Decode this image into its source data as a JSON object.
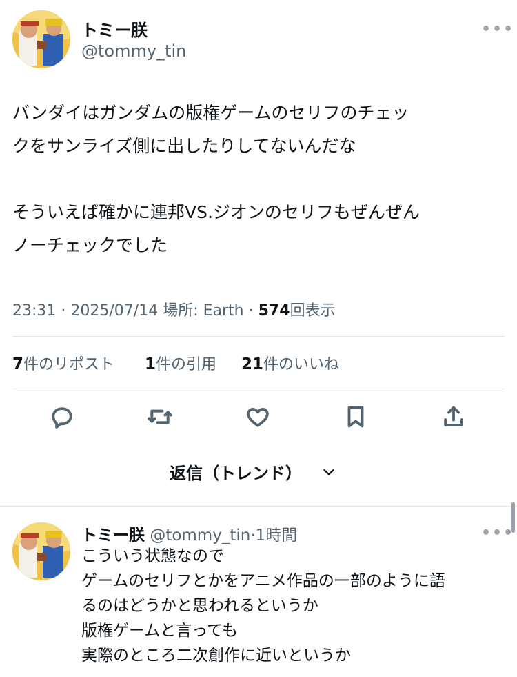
{
  "main_tweet": {
    "author": {
      "display_name": "トミー朕",
      "handle": "@tommy_tin"
    },
    "body": "バンダイはガンダムの版権ゲームのセリフのチェッ\nクをサンライズ側に出したりしてないんだな\n\nそういえば確かに連邦VS.ジオンのセリフもぜんぜん\nノーチェックでした",
    "meta": {
      "time": "23:31",
      "date": "2025/07/14",
      "location": "場所: Earth",
      "views_count": "574",
      "views_label": "回表示"
    },
    "stats": {
      "reposts": {
        "count": "7",
        "label": "件のリポスト"
      },
      "quotes": {
        "count": "1",
        "label": "件の引用"
      },
      "likes": {
        "count": "21",
        "label": "件のいいね"
      }
    },
    "actions": [
      "reply-icon",
      "repost-icon",
      "like-icon",
      "bookmark-icon",
      "share-icon"
    ]
  },
  "replies_sort": {
    "label": "返信（トレンド）"
  },
  "reply_tweet": {
    "author": {
      "display_name": "トミー朕",
      "handle": "@tommy_tin",
      "time": "1時間"
    },
    "body": "こういう状態なので\nゲームのセリフとかをアニメ作品の一部のように語\nるのはどうかと思われるというか\n版権ゲームと言っても\n実際のところ二次創作に近いというか"
  },
  "more_label": "•••",
  "dot_sep": "·",
  "colors": {
    "text": "#0f1419",
    "secondary": "#536471",
    "divider": "#e1e5e8"
  }
}
